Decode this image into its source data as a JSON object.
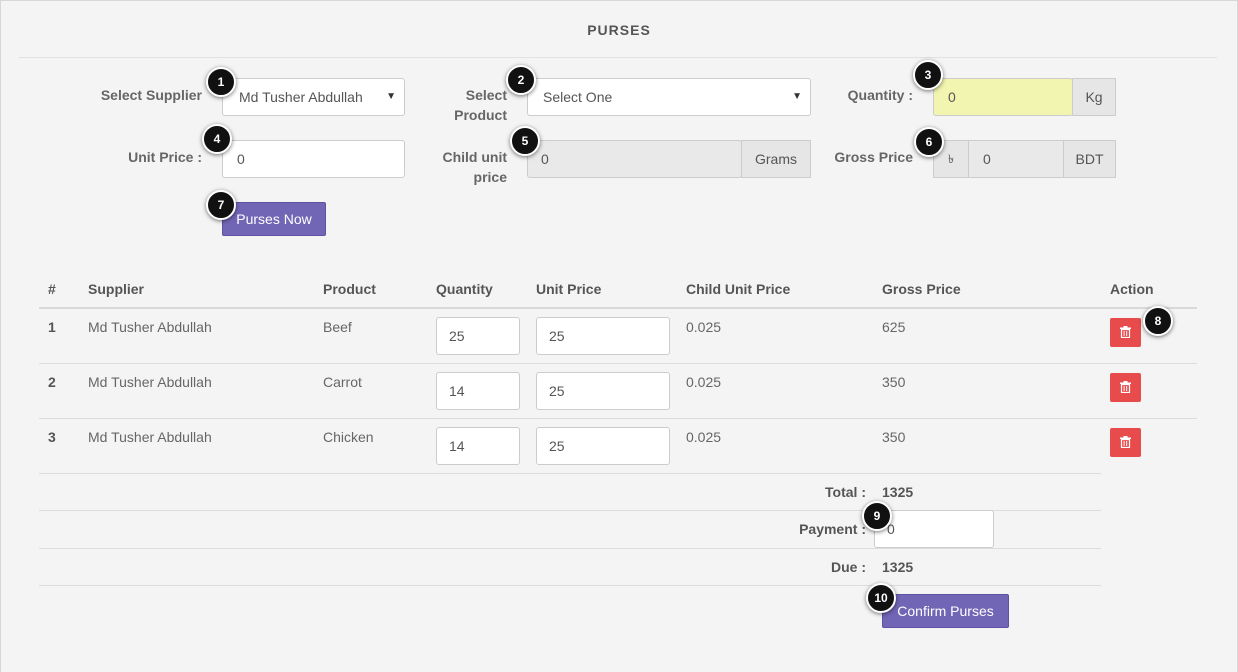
{
  "page": {
    "title": "PURSES"
  },
  "form": {
    "supplier_label": "Select Supplier",
    "supplier_value": "Md Tusher Abdullah",
    "product_label_1": "Select",
    "product_label_2": "Product",
    "product_value": "Select One",
    "quantity_label": "Quantity :",
    "quantity_value": "0",
    "quantity_unit": "Kg",
    "unit_price_label": "Unit Price :",
    "unit_price_value": "0",
    "child_unit_label_1": "Child unit",
    "child_unit_label_2": "price",
    "child_unit_value": "0",
    "child_unit_unit": "Grams",
    "gross_price_label": "Gross Price",
    "gross_price_value": "0",
    "gross_price_currency_symbol": "৳",
    "gross_price_unit": "BDT",
    "purses_now_button": "Purses Now"
  },
  "table": {
    "headers": [
      "#",
      "Supplier",
      "Product",
      "Quantity",
      "Unit Price",
      "Child Unit Price",
      "Gross Price",
      "Action"
    ],
    "rows": [
      {
        "num": "1",
        "supplier": "Md Tusher Abdullah",
        "product": "Beef",
        "quantity": "25",
        "unit_price": "25",
        "child_unit_price": "0.025",
        "gross_price": "625"
      },
      {
        "num": "2",
        "supplier": "Md Tusher Abdullah",
        "product": "Carrot",
        "quantity": "14",
        "unit_price": "25",
        "child_unit_price": "0.025",
        "gross_price": "350"
      },
      {
        "num": "3",
        "supplier": "Md Tusher Abdullah",
        "product": "Chicken",
        "quantity": "14",
        "unit_price": "25",
        "child_unit_price": "0.025",
        "gross_price": "350"
      }
    ]
  },
  "summary": {
    "total_label": "Total :",
    "total_value": "1325",
    "payment_label": "Payment :",
    "payment_value": "0",
    "due_label": "Due :",
    "due_value": "1325",
    "confirm_button": "Confirm Purses"
  },
  "callouts": [
    "1",
    "2",
    "3",
    "4",
    "5",
    "6",
    "7",
    "8",
    "9",
    "10"
  ],
  "colors": {
    "primary_button": "#7165b5",
    "delete_button": "#e84b4b",
    "quantity_highlight": "#f2f5b0",
    "callout": "#111111"
  },
  "icons": {
    "delete": "trash-icon",
    "dropdown": "caret-down-icon",
    "currency": "taka-icon"
  }
}
